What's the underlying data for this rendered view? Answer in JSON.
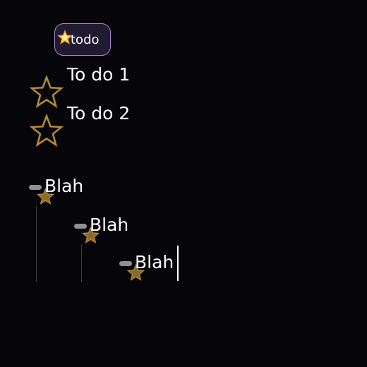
{
  "tag": {
    "label": "todo",
    "icon": "glowing-star-icon"
  },
  "todos": [
    {
      "label": "To do 1",
      "icon": "star-outline-icon"
    },
    {
      "label": "To do 2",
      "icon": "star-outline-icon"
    }
  ],
  "bullets": [
    {
      "label": "Blah",
      "icon": "star-filled-icon",
      "depth": 0
    },
    {
      "label": "Blah",
      "icon": "star-filled-icon",
      "depth": 1
    },
    {
      "label": "Blah",
      "icon": "star-filled-icon",
      "depth": 2
    }
  ],
  "colors": {
    "background": "#05050a",
    "star_gold": "#b58a38",
    "tag_border": "#a98ad1",
    "tag_fill": "#221a33",
    "text": "#ffffff",
    "bullet_pill": "#8f8f96"
  }
}
